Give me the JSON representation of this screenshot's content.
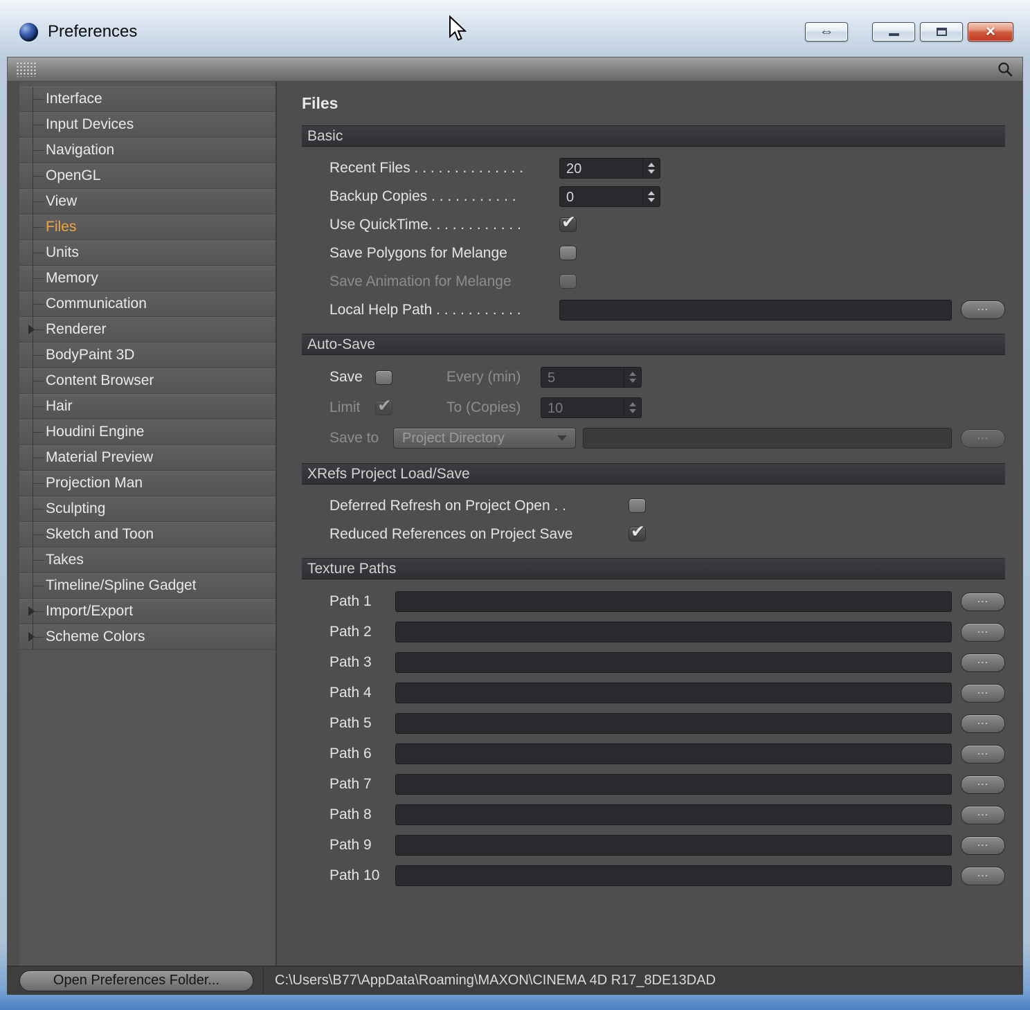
{
  "window": {
    "title": "Preferences",
    "controls": {
      "dock": "⇔",
      "close": "×"
    }
  },
  "sidebar": {
    "items": [
      {
        "label": "Interface"
      },
      {
        "label": "Input Devices"
      },
      {
        "label": "Navigation"
      },
      {
        "label": "OpenGL"
      },
      {
        "label": "View"
      },
      {
        "label": "Files",
        "selected": true
      },
      {
        "label": "Units"
      },
      {
        "label": "Memory"
      },
      {
        "label": "Communication"
      },
      {
        "label": "Renderer",
        "expandable": true
      },
      {
        "label": "BodyPaint 3D"
      },
      {
        "label": "Content Browser"
      },
      {
        "label": "Hair"
      },
      {
        "label": "Houdini Engine"
      },
      {
        "label": "Material Preview"
      },
      {
        "label": "Projection Man"
      },
      {
        "label": "Sculpting"
      },
      {
        "label": "Sketch and Toon"
      },
      {
        "label": "Takes"
      },
      {
        "label": "Timeline/Spline Gadget"
      },
      {
        "label": "Import/Export",
        "expandable": true
      },
      {
        "label": "Scheme Colors",
        "expandable": true
      }
    ]
  },
  "main": {
    "title": "Files",
    "basic": {
      "header": "Basic",
      "recent_files_label": "Recent Files . . . . . . . . . . . . . .",
      "recent_files_value": "20",
      "backup_copies_label": "Backup Copies . . . . . . . . . . .",
      "backup_copies_value": "0",
      "use_quicktime_label": "Use QuickTime. . . . . . . . . . . .",
      "use_quicktime_checked": true,
      "save_polygons_label": "Save Polygons for Melange",
      "save_polygons_checked": false,
      "save_animation_label": "Save Animation for Melange",
      "save_animation_checked": false,
      "save_animation_disabled": true,
      "local_help_path_label": "Local Help Path . . . . . . . . . . .",
      "local_help_path_value": "",
      "browse_label": "..."
    },
    "auto_save": {
      "header": "Auto-Save",
      "save_label": "Save",
      "save_checked": false,
      "every_label": "Every (min)",
      "every_value": "5",
      "every_disabled": true,
      "limit_label": "Limit",
      "limit_checked": true,
      "limit_disabled": true,
      "to_copies_label": "To (Copies)",
      "to_copies_value": "10",
      "to_copies_disabled": true,
      "save_to_label": "Save to",
      "save_to_value": "Project Directory",
      "save_to_disabled": true,
      "save_to_path_value": "",
      "browse_label": "..."
    },
    "xrefs": {
      "header": "XRefs Project Load/Save",
      "deferred_label": "Deferred Refresh on Project Open . .",
      "deferred_checked": false,
      "reduced_label": "Reduced References on Project Save",
      "reduced_checked": true
    },
    "texture_paths": {
      "header": "Texture Paths",
      "browse_label": "...",
      "paths": [
        {
          "label": "Path 1",
          "value": ""
        },
        {
          "label": "Path 2",
          "value": ""
        },
        {
          "label": "Path 3",
          "value": ""
        },
        {
          "label": "Path 4",
          "value": ""
        },
        {
          "label": "Path 5",
          "value": ""
        },
        {
          "label": "Path 6",
          "value": ""
        },
        {
          "label": "Path 7",
          "value": ""
        },
        {
          "label": "Path 8",
          "value": ""
        },
        {
          "label": "Path 9",
          "value": ""
        },
        {
          "label": "Path 10",
          "value": ""
        }
      ]
    }
  },
  "footer": {
    "button_label": "Open Preferences Folder...",
    "path": "C:\\Users\\B77\\AppData\\Roaming\\MAXON\\CINEMA 4D R17_8DE13DAD"
  }
}
